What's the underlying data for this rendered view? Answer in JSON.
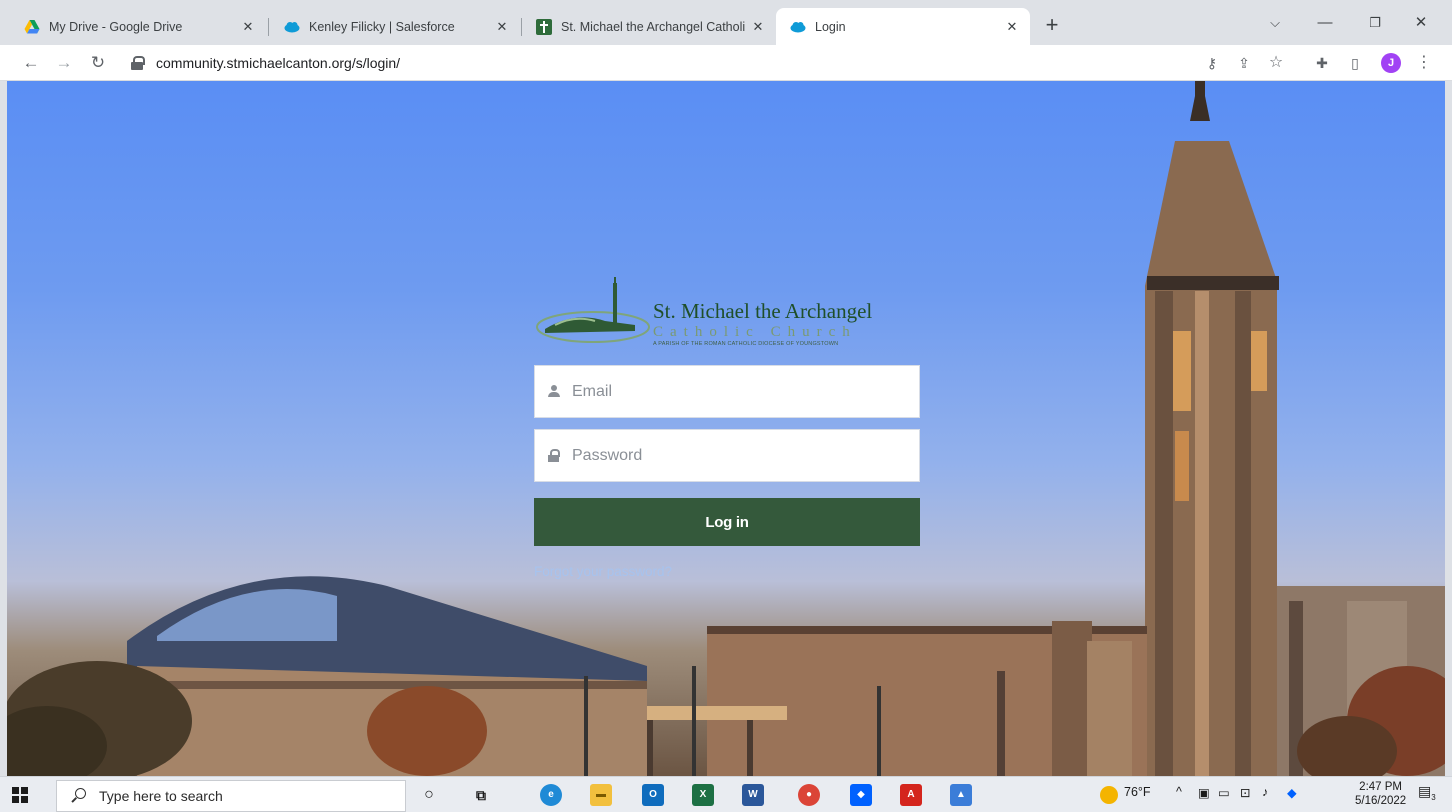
{
  "browser": {
    "tabs": [
      {
        "label": "My Drive - Google Drive",
        "icon": "google-drive-icon",
        "active": false
      },
      {
        "label": "Kenley Filicky | Salesforce",
        "icon": "salesforce-cloud-icon",
        "active": false
      },
      {
        "label": "St. Michael the Archangel Catholi",
        "icon": "church-cross-icon",
        "active": false
      },
      {
        "label": "Login",
        "icon": "salesforce-cloud-icon",
        "active": true
      }
    ],
    "url": "community.stmichaelcanton.org/s/login/",
    "profile_initial": "J"
  },
  "logo": {
    "title": "St. Michael the Archangel",
    "subtitle": "Catholic Church",
    "tagline": "A PARISH OF THE ROMAN CATHOLIC DIOCESE OF YOUNGSTOWN"
  },
  "form": {
    "email_placeholder": "Email",
    "password_placeholder": "Password",
    "login_label": "Log in",
    "forgot_label": "Forgot your password?"
  },
  "taskbar": {
    "search_placeholder": "Type here to search",
    "weather": "76°F",
    "time": "2:47 PM",
    "date": "5/16/2022",
    "notifications": "3"
  },
  "colors": {
    "login_button": "#34593b",
    "forgot_link": "#a7c3ee",
    "logo_green": "#1f4f29"
  }
}
